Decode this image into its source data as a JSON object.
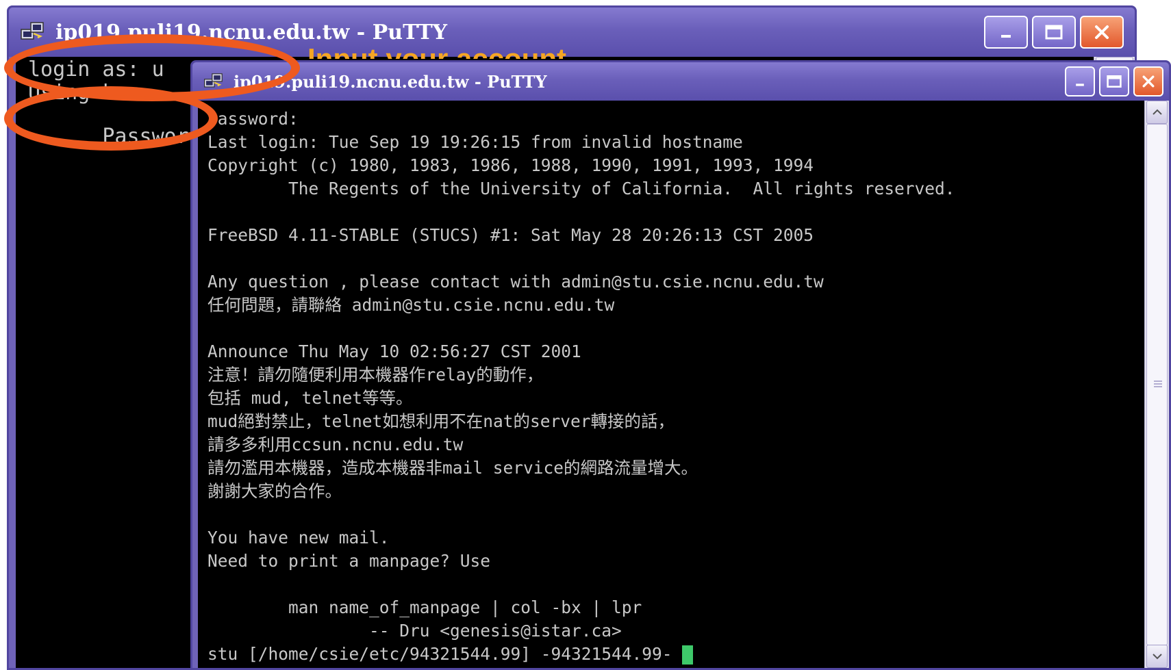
{
  "back_window": {
    "title": "ip019.puli19.ncnu.edu.tw - PuTTY",
    "lines": {
      "login": "login as: u",
      "using": "Using k",
      "password": "Password:"
    }
  },
  "front_window": {
    "title": "ip019.puli19.ncnu.edu.tw - PuTTY",
    "terminal_lines": [
      "Password:",
      "Last login: Tue Sep 19 19:26:15 from invalid hostname",
      "Copyright (c) 1980, 1983, 1986, 1988, 1990, 1991, 1993, 1994",
      "        The Regents of the University of California.  All rights reserved.",
      "",
      "FreeBSD 4.11-STABLE (STUCS) #1: Sat May 28 20:26:13 CST 2005",
      "",
      "Any question , please contact with admin@stu.csie.ncnu.edu.tw",
      "任何問題，請聯絡 admin@stu.csie.ncnu.edu.tw",
      "",
      "Announce Thu May 10 02:56:27 CST 2001",
      "注意！請勿隨便利用本機器作relay的動作，",
      "包括 mud, telnet等等。",
      "mud絕對禁止，telnet如想利用不在nat的server轉接的話，",
      "請多多利用ccsun.ncnu.edu.tw",
      "請勿濫用本機器，造成本機器非mail service的網路流量增大。",
      "謝謝大家的合作。",
      "",
      "You have new mail.",
      "Need to print a manpage? Use",
      "",
      "        man name_of_manpage | col -bx | lpr",
      "                -- Dru <genesis@istar.ca>",
      "stu [/home/csie/etc/94321544.99] -94321544.99- "
    ]
  },
  "annotation": {
    "text": "Input your account",
    "color": "#f5a623"
  },
  "colors": {
    "highlight_ellipse": "#ee5a1f",
    "cursor": "#3ec96a",
    "title_bar": "#6a5fba",
    "close_button": "#e2582c"
  },
  "icons": [
    "putty-icon",
    "minimize-icon",
    "maximize-icon",
    "close-icon",
    "scroll-up-icon",
    "scroll-down-icon",
    "scroll-grip-icon"
  ]
}
